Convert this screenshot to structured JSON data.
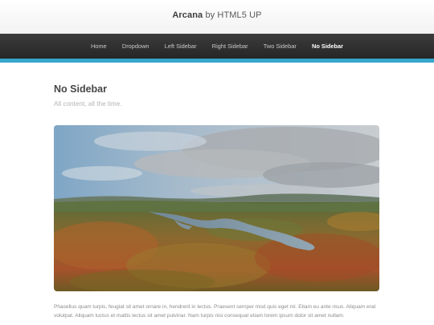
{
  "header": {
    "brand": "Arcana",
    "byline": "by HTML5 UP"
  },
  "nav": {
    "items": [
      {
        "label": "Home",
        "active": false
      },
      {
        "label": "Dropdown",
        "active": false
      },
      {
        "label": "Left Sidebar",
        "active": false
      },
      {
        "label": "Right Sidebar",
        "active": false
      },
      {
        "label": "Two Sidebar",
        "active": false
      },
      {
        "label": "No Sidebar",
        "active": true
      }
    ]
  },
  "main": {
    "title": "No Sidebar",
    "subtitle": "All content, all the time.",
    "body": "Phasellus quam turpis, feugiat sit amet ornare in, hendrerit in lectus. Praesent semper mod quis eget mi. Etiam eu ante risus. Aliquam erat volutpat. Aliquam luctus et mattis lectus sit amet pulvinar. Nam turpis nisi consequat etiam lorem ipsum dolor sit amet nullam."
  },
  "colors": {
    "accent": "#37a6cd",
    "nav_bg": "#2e2e2e"
  }
}
